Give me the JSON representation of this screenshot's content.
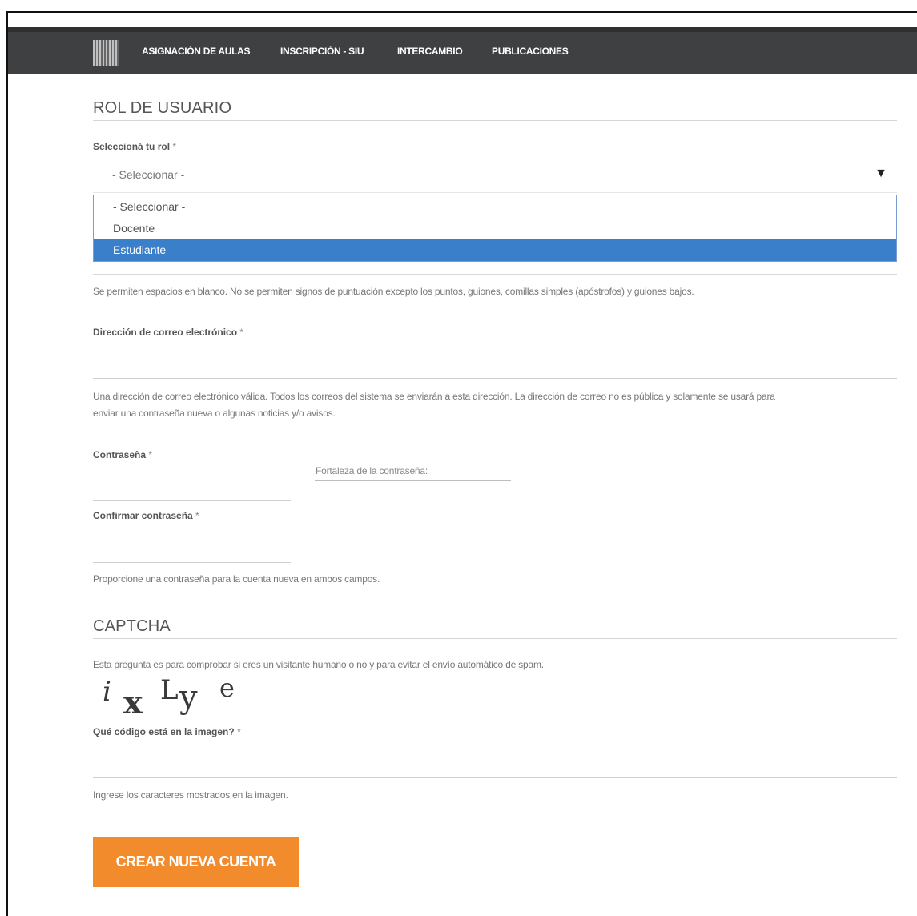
{
  "nav": {
    "items": [
      "ASIGNACIÓN DE AULAS",
      "INSCRIPCIÓN - SIU",
      "INTERCAMBIO",
      "PUBLICACIONES"
    ]
  },
  "rol": {
    "section_title": "ROL DE USUARIO",
    "label": "Seleccioná tu rol",
    "required_mark": "*",
    "selected_value": "- Seleccionar -",
    "options": [
      "- Seleccionar -",
      "Docente",
      "Estudiante"
    ],
    "highlighted_option": "Estudiante",
    "help": "Se permiten espacios en blanco. No se permiten signos de puntuación excepto los puntos, guiones, comillas simples (apóstrofos) y guiones bajos."
  },
  "email": {
    "label": "Dirección de correo electrónico",
    "required_mark": "*",
    "help_line1": "Una dirección de correo electrónico válida. Todos los correos del sistema se enviarán a esta dirección. La dirección de correo no es pública y solamente se usará para",
    "help_line2": "enviar una contraseña nueva o algunas noticias y/o avisos."
  },
  "password": {
    "label": "Contraseña",
    "required_mark": "*",
    "strength_label": "Fortaleza de la contraseña:",
    "confirm_label": "Confirmar contraseña",
    "help": "Proporcione una contraseña para la cuenta nueva en ambos campos."
  },
  "captcha": {
    "section_title": "CAPTCHA",
    "description": "Esta pregunta es para comprobar si eres un visitante humano o no y para evitar el envío automático de spam.",
    "image_chars": [
      "i",
      "x",
      "L",
      "y",
      "e"
    ],
    "question_label": "Qué código está en la imagen?",
    "required_mark": "*",
    "help": "Ingrese los caracteres mostrados en la imagen."
  },
  "submit": {
    "label": "CREAR NUEVA CUENTA"
  },
  "colors": {
    "topbar": "#3f4042",
    "selected_option": "#3a7fc9",
    "button": "#f28b2b"
  }
}
